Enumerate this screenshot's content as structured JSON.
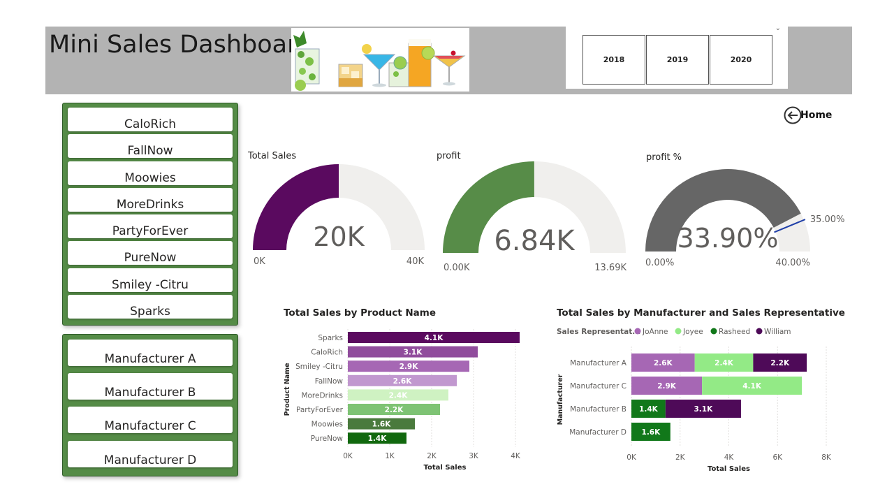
{
  "header": {
    "title": "Mini Sales Dashboard"
  },
  "year_slicer": {
    "years": [
      "2018",
      "2019",
      "2020"
    ]
  },
  "home": {
    "label": "Home"
  },
  "product_buttons": [
    "CaloRich",
    "FallNow",
    "Moowies",
    "MoreDrinks",
    "PartyForEver",
    "PureNow",
    "Smiley -Citru",
    "Sparks"
  ],
  "manufacturer_buttons": [
    "Manufacturer A",
    "Manufacturer B",
    "Manufacturer C",
    "Manufacturer D"
  ],
  "gauges": [
    {
      "title": "Total Sales",
      "value": 20,
      "min": 0,
      "max": 40,
      "value_label": "20K",
      "min_label": "0K",
      "max_label": "40K",
      "color": "#5a0a5f"
    },
    {
      "title": "profit",
      "value": 6.84,
      "min": 0,
      "max": 13.69,
      "value_label": "6.84K",
      "min_label": "0.00K",
      "max_label": "13.69K",
      "color": "#578c48"
    },
    {
      "title": "profit %",
      "value": 33.9,
      "min": 0,
      "max": 40,
      "target": 35,
      "value_label": "33.90%",
      "min_label": "0.00%",
      "max_label": "40.00%",
      "target_label": "35.00%",
      "color": "#666666"
    }
  ],
  "chart_data": [
    {
      "type": "bar",
      "orientation": "horizontal",
      "title": "Total Sales by Product Name",
      "xlabel": "Total Sales",
      "ylabel": "Product Name",
      "categories": [
        "Sparks",
        "CaloRich",
        "Smiley -Citru",
        "FallNow",
        "MoreDrinks",
        "PartyForEver",
        "Moowies",
        "PureNow"
      ],
      "values": [
        4.1,
        3.1,
        2.9,
        2.6,
        2.4,
        2.2,
        1.6,
        1.4
      ],
      "data_labels": [
        "4.1K",
        "3.1K",
        "2.9K",
        "2.6K",
        "2.4K",
        "2.2K",
        "1.6K",
        "1.4K"
      ],
      "colors": [
        "#5a0a5f",
        "#904c9c",
        "#a667b4",
        "#c198cf",
        "#cff2c2",
        "#7ec374",
        "#4a7a3d",
        "#11680e"
      ],
      "x_ticks": [
        "0K",
        "1K",
        "2K",
        "3K",
        "4K"
      ],
      "xlim": [
        0,
        4.3
      ],
      "grid": true
    },
    {
      "type": "bar",
      "orientation": "horizontal",
      "stacked": true,
      "title": "Total Sales by Manufacturer and Sales Representative",
      "xlabel": "Total Sales",
      "ylabel": "Manufacturer",
      "legend_title": "Sales Representat...",
      "legend_position": "top-left",
      "categories": [
        "Manufacturer A",
        "Manufacturer C",
        "Manufacturer B",
        "Manufacturer D"
      ],
      "series": [
        {
          "name": "JoAnne",
          "color": "#a667b4",
          "values": [
            2.6,
            2.9,
            0,
            0
          ],
          "labels": [
            "2.6K",
            "2.9K",
            "",
            ""
          ]
        },
        {
          "name": "Joyee",
          "color": "#93ea86",
          "values": [
            2.4,
            4.1,
            0,
            0
          ],
          "labels": [
            "2.4K",
            "4.1K",
            "",
            ""
          ]
        },
        {
          "name": "Rasheed",
          "color": "#11781a",
          "values": [
            0,
            0,
            1.4,
            1.6
          ],
          "labels": [
            "",
            "",
            "1.4K",
            "1.6K"
          ]
        },
        {
          "name": "William",
          "color": "#4e0a58",
          "values": [
            2.2,
            0,
            3.1,
            0
          ],
          "labels": [
            "2.2K",
            "",
            "3.1K",
            ""
          ]
        }
      ],
      "x_ticks": [
        "0K",
        "2K",
        "4K",
        "6K",
        "8K"
      ],
      "xlim": [
        0,
        8
      ],
      "grid": true
    }
  ]
}
